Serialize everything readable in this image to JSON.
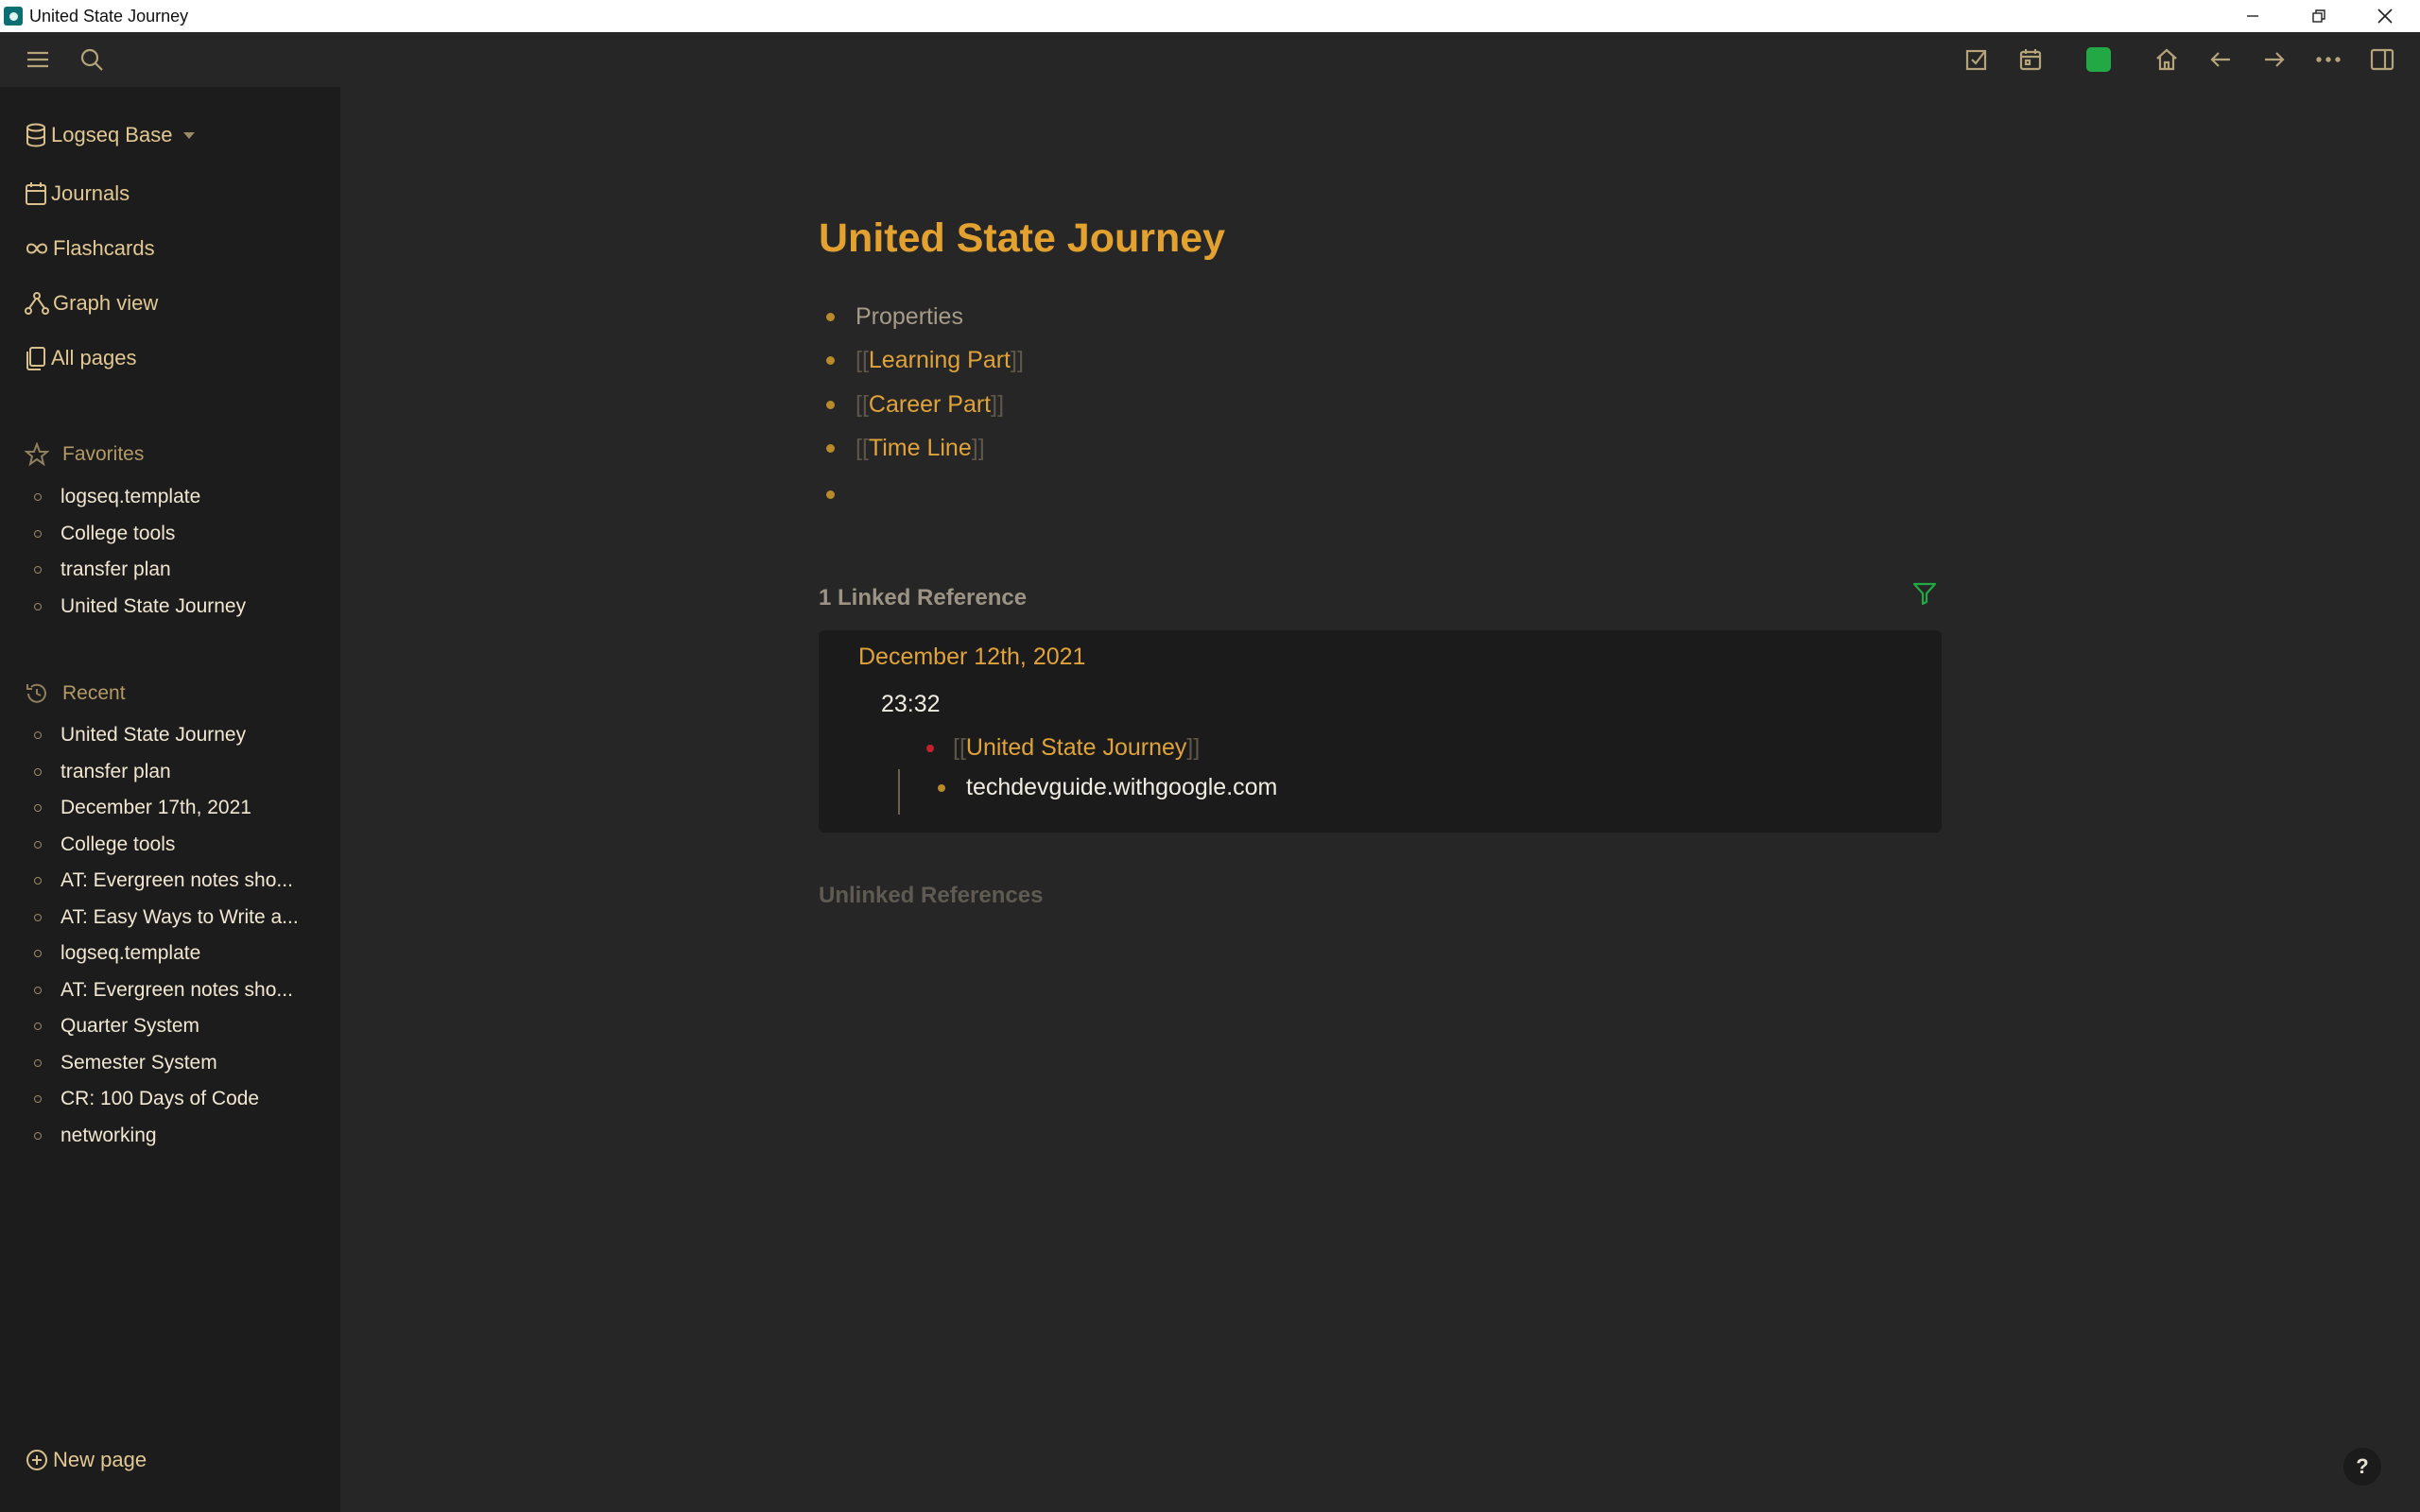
{
  "window": {
    "title": "United State Journey",
    "controls": [
      "—",
      "❐",
      "✕"
    ]
  },
  "toolbar": {
    "left": [
      "menu-icon",
      "search-icon"
    ],
    "right": [
      "todo-check-icon",
      "calendar-icon",
      "sync-status-icon",
      "home-icon",
      "back-arrow-icon",
      "forward-arrow-icon",
      "more-icon",
      "right-sidebar-icon"
    ],
    "sync_color": "#22a845"
  },
  "sidebar": {
    "graph_name": "Logseq Base",
    "nav": [
      {
        "label": "Journals",
        "icon": "calendar-icon"
      },
      {
        "label": "Flashcards",
        "icon": "infinity-icon"
      },
      {
        "label": "Graph view",
        "icon": "graph-icon"
      },
      {
        "label": "All pages",
        "icon": "pages-icon"
      }
    ],
    "favorites_label": "Favorites",
    "favorites": [
      "logseq.template",
      "College tools",
      "transfer plan",
      "United State Journey"
    ],
    "recent_label": "Recent",
    "recent": [
      "United State Journey",
      "transfer plan",
      "December 17th, 2021",
      "College tools",
      "AT: Evergreen notes sho...",
      "AT: Easy Ways to Write a...",
      "logseq.template",
      "AT: Evergreen notes sho...",
      "Quarter System",
      "Semester System",
      "CR: 100 Days of Code",
      "networking"
    ],
    "new_page_label": "New page"
  },
  "page": {
    "title": "United State Journey",
    "blocks": {
      "properties": "Properties",
      "link1": "Learning Part",
      "link2": "Career Part",
      "link3": "Time Line",
      "open_bracket": "[[",
      "close_bracket": "]]"
    },
    "linked_refs_heading": "1 Linked Reference",
    "ref": {
      "date": "December 12th, 2021",
      "time": "23:32",
      "page_link": "United State Journey",
      "child": "techdevguide.withgoogle.com"
    },
    "unlinked_heading": "Unlinked References"
  },
  "help": {
    "label": "?"
  },
  "colors": {
    "accent": "#e3a12f",
    "link": "#e0a33a",
    "background": "#262626",
    "sidebar": "#1c1c1c",
    "filter_icon": "#22a845"
  }
}
